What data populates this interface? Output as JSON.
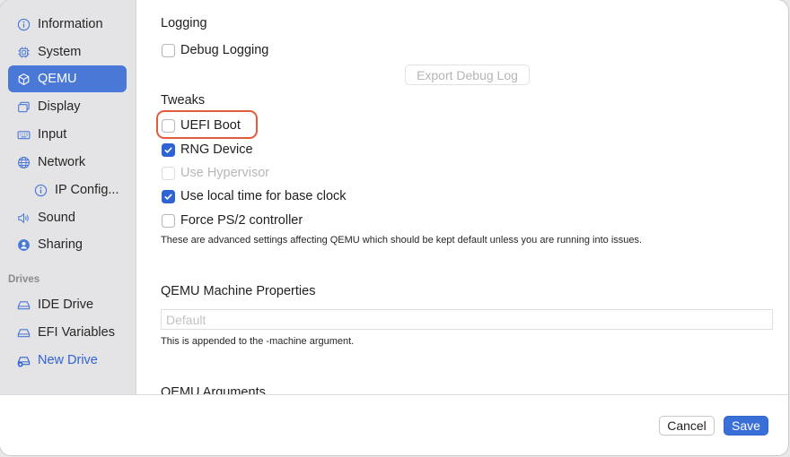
{
  "sidebar": {
    "items": [
      {
        "label": "Information",
        "icon": "info-circle-icon"
      },
      {
        "label": "System",
        "icon": "chip-icon"
      },
      {
        "label": "QEMU",
        "icon": "cube-icon",
        "selected": true
      },
      {
        "label": "Display",
        "icon": "display-icon"
      },
      {
        "label": "Input",
        "icon": "keyboard-icon"
      },
      {
        "label": "Network",
        "icon": "globe-icon"
      },
      {
        "label": "IP Config...",
        "icon": "info-circle-icon"
      },
      {
        "label": "Sound",
        "icon": "speaker-icon"
      },
      {
        "label": "Sharing",
        "icon": "person-circle-icon"
      }
    ],
    "drives_section": "Drives",
    "drives": [
      {
        "label": "IDE Drive",
        "icon": "drive-icon"
      },
      {
        "label": "EFI Variables",
        "icon": "drive-icon"
      },
      {
        "label": "New Drive",
        "icon": "drive-add-icon"
      }
    ]
  },
  "logging": {
    "heading": "Logging",
    "debug_logging_label": "Debug Logging",
    "debug_logging_checked": false,
    "export_button": "Export Debug Log"
  },
  "tweaks": {
    "heading": "Tweaks",
    "options": [
      {
        "label": "UEFI Boot",
        "checked": false,
        "disabled": false
      },
      {
        "label": "RNG Device",
        "checked": true,
        "disabled": false
      },
      {
        "label": "Use Hypervisor",
        "checked": false,
        "disabled": true
      },
      {
        "label": "Use local time for base clock",
        "checked": true,
        "disabled": false
      },
      {
        "label": "Force PS/2 controller",
        "checked": false,
        "disabled": false
      }
    ],
    "note": "These are advanced settings affecting QEMU which should be kept default unless you are running into issues."
  },
  "machine_properties": {
    "heading": "QEMU Machine Properties",
    "placeholder": "Default",
    "value": "",
    "note": "This is appended to the -machine argument."
  },
  "arguments": {
    "heading": "QEMU Arguments"
  },
  "footer": {
    "cancel_label": "Cancel",
    "save_label": "Save"
  },
  "colors": {
    "accent": "#3a6fd8",
    "highlight": "#e25b3c"
  }
}
